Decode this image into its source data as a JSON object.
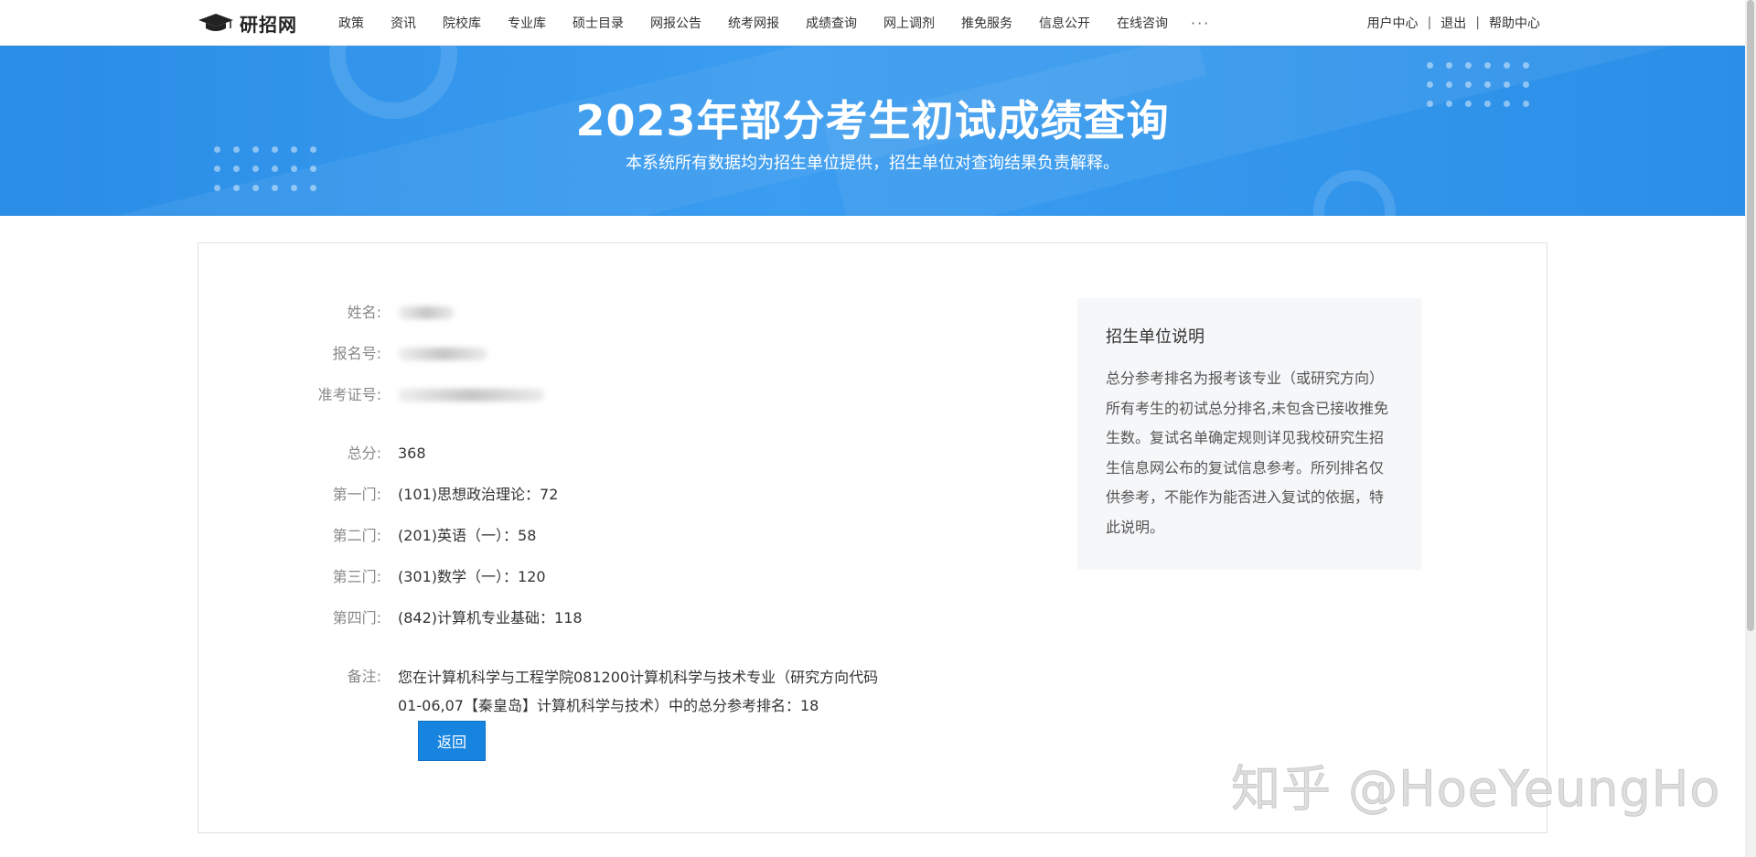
{
  "header": {
    "logo_text": "研招网",
    "nav_items": [
      "政策",
      "资讯",
      "院校库",
      "专业库",
      "硕士目录",
      "网报公告",
      "统考网报",
      "成绩查询",
      "网上调剂",
      "推免服务",
      "信息公开",
      "在线咨询"
    ],
    "more_label": "···",
    "user_links": {
      "user_center": "用户中心",
      "logout": "退出",
      "help": "帮助中心",
      "separator": "|"
    }
  },
  "banner": {
    "title": "2023年部分考生初试成绩查询",
    "subtitle": "本系统所有数据均为招生单位提供，招生单位对查询结果负责解释。"
  },
  "result": {
    "name": {
      "label": "姓名:"
    },
    "registration_no": {
      "label": "报名号:"
    },
    "admission_ticket_no": {
      "label": "准考证号:"
    },
    "total": {
      "label": "总分:",
      "value": "368"
    },
    "subjects": [
      {
        "label": "第一门:",
        "value": "(101)思想政治理论：72"
      },
      {
        "label": "第二门:",
        "value": "(201)英语（一）：58"
      },
      {
        "label": "第三门:",
        "value": "(301)数学（一）：120"
      },
      {
        "label": "第四门:",
        "value": "(842)计算机专业基础：118"
      }
    ],
    "remark": {
      "label": "备注:",
      "value": "您在计算机科学与工程学院081200计算机科学与技术专业（研究方向代码01-06,07【秦皇岛】计算机科学与技术）中的总分参考排名：18"
    },
    "back_button": "返回"
  },
  "notice": {
    "title": "招生单位说明",
    "body": "总分参考排名为报考该专业（或研究方向）所有考生的初试总分排名,未包含已接收推免生数。复试名单确定规则详见我校研究生招生信息网公布的复试信息参考。所列排名仅供参考，不能作为能否进入复试的依据，特此说明。"
  },
  "watermark": "知乎 @HoeYeungHo",
  "colors": {
    "banner": "#2a8de6",
    "button": "#1784e0",
    "notice_bg": "#f6f7f9"
  }
}
